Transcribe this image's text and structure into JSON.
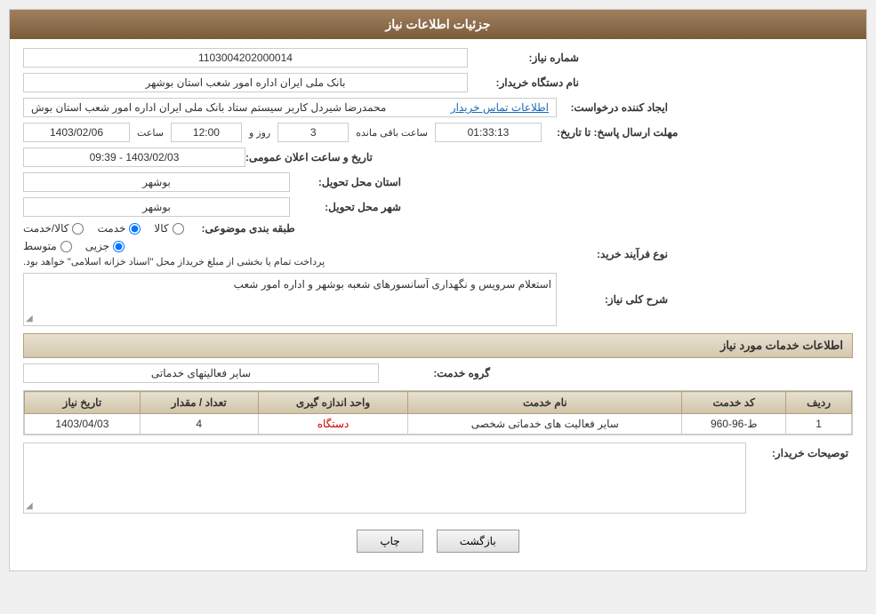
{
  "header": {
    "title": "جزئیات اطلاعات نیاز"
  },
  "fields": {
    "request_number_label": "شماره نیاز:",
    "request_number_value": "1103004202000014",
    "buyer_org_label": "نام دستگاه خریدار:",
    "buyer_org_value": "بانک ملی ایران اداره امور شعب استان بوشهر",
    "requester_label": "ایجاد کننده درخواست:",
    "requester_value": "محمدرضا شیردل کاربر سیستم ستاد بانک ملی ایران اداره امور شعب استان بوش",
    "requester_link": "اطلاعات تماس خریدار",
    "response_deadline_label": "مهلت ارسال پاسخ: تا تاریخ:",
    "deadline_date": "1403/02/06",
    "deadline_time_label": "ساعت",
    "deadline_time": "12:00",
    "deadline_days_label": "روز و",
    "deadline_days": "3",
    "deadline_remaining_label": "ساعت باقی مانده",
    "deadline_remaining": "01:33:13",
    "announce_label": "تاریخ و ساعت اعلان عمومی:",
    "announce_value": "1403/02/03 - 09:39",
    "province_label": "استان محل تحویل:",
    "province_value": "بوشهر",
    "city_label": "شهر محل تحویل:",
    "city_value": "بوشهر",
    "subject_label": "طبقه بندی موضوعی:",
    "subject_options": [
      {
        "label": "کالا",
        "value": "kala"
      },
      {
        "label": "خدمت",
        "value": "khedmat"
      },
      {
        "label": "کالا/خدمت",
        "value": "kala_khedmat"
      }
    ],
    "subject_selected": "khedmat",
    "purchase_type_label": "نوع فرآیند خرید:",
    "purchase_options": [
      {
        "label": "جزیی",
        "value": "jozi"
      },
      {
        "label": "متوسط",
        "value": "mottavaset"
      }
    ],
    "purchase_note": "پرداخت تمام یا بخشی از مبلغ خریداز محل \"اسناد خزانه اسلامی\" خواهد بود.",
    "description_label": "شرح کلی نیاز:",
    "description_value": "استعلام سرویس و نگهداری آسانسورهای شعبه بوشهر و اداره امور شعب",
    "services_section_title": "اطلاعات خدمات مورد نیاز",
    "service_group_label": "گروه خدمت:",
    "service_group_value": "سایر فعالیتهای خدماتی",
    "table": {
      "headers": [
        "ردیف",
        "کد خدمت",
        "نام خدمت",
        "واحد اندازه گیری",
        "تعداد / مقدار",
        "تاریخ نیاز"
      ],
      "rows": [
        {
          "row": "1",
          "code": "ط-96-960",
          "name": "سایر فعالیت های خدماتی شخصی",
          "unit": "دستگاه",
          "quantity": "4",
          "date": "1403/04/03"
        }
      ]
    },
    "buyer_desc_label": "توصیحات خریدار:"
  },
  "buttons": {
    "print": "چاپ",
    "back": "بازگشت"
  }
}
